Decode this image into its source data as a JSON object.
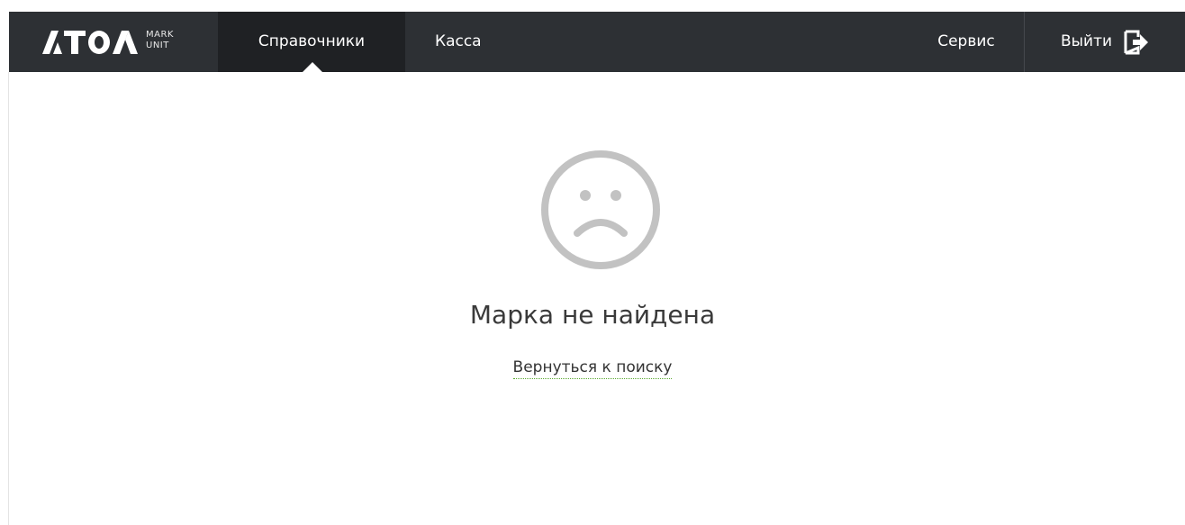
{
  "brand": {
    "logo_text": "ATOL",
    "sub_line1": "MARK",
    "sub_line2": "UNIT"
  },
  "nav": {
    "directories": "Справочники",
    "cashier": "Касса",
    "service": "Сервис",
    "logout": "Выйти"
  },
  "colors": {
    "navbar_bg": "#2d3034",
    "active_tab_bg": "#1f2124",
    "icon_gray": "#c2c2c2",
    "link_underline": "#59a82f"
  },
  "empty_state": {
    "icon": "sad-face-icon",
    "message": "Марка не найдена",
    "back_link": "Вернуться к поиску"
  }
}
